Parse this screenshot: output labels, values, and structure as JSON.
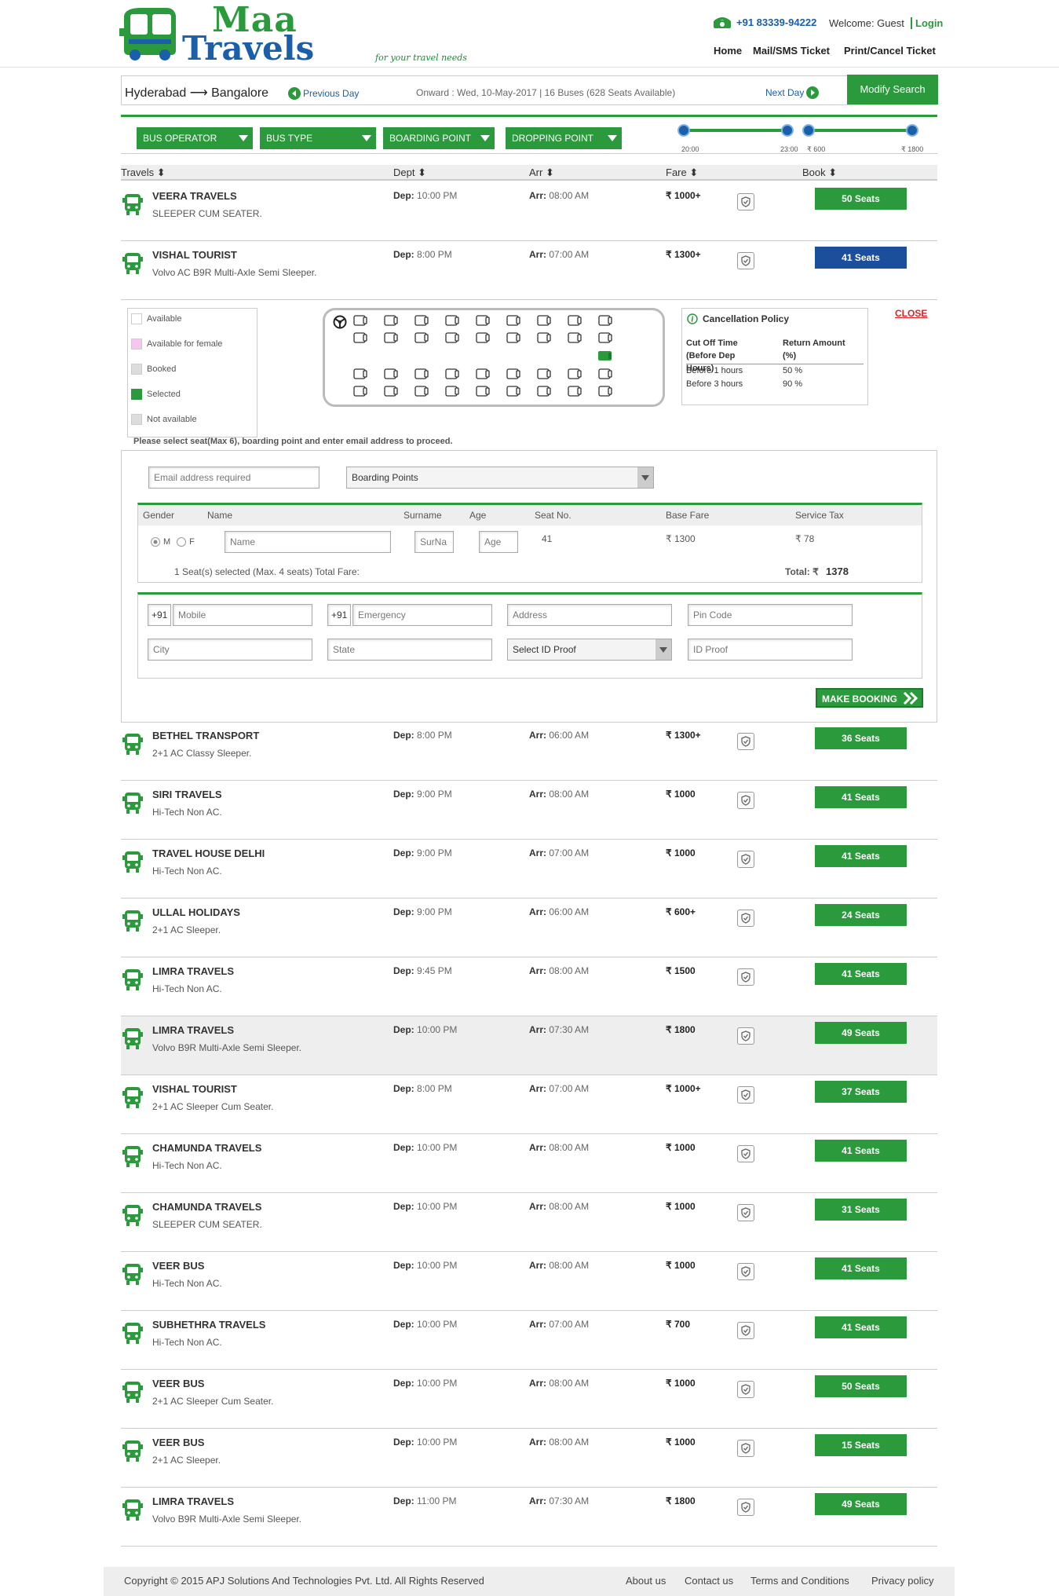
{
  "brand": {
    "name_top": "Maa",
    "name_bottom": "Travels",
    "tagline": "for your travel needs"
  },
  "header": {
    "phone": "+91 83339-94222",
    "welcome": "Welcome: Guest",
    "login": "Login",
    "nav": [
      "Home",
      "Mail/SMS Ticket",
      "Print/Cancel Ticket"
    ]
  },
  "search": {
    "route": "Hyderabad ⟶ Bangalore",
    "prev_day": "Previous Day",
    "onward": "Onward : Wed, 10-May-2017 | 16 Buses (628 Seats Available)",
    "next_day": "Next Day",
    "modify": "Modify Search"
  },
  "filters": {
    "items": [
      "BUS OPERATOR",
      "BUS TYPE",
      "BOARDING POINT",
      "DROPPING POINT"
    ],
    "time_min": "20:00",
    "time_max": "23:00",
    "fare_min": "₹ 600",
    "fare_max": "₹ 1800"
  },
  "columns": [
    "Travels ⬍",
    "Dept ⬍",
    "Arr ⬍",
    "Fare ⬍",
    "Book ⬍"
  ],
  "labels": {
    "dep": "Dep:",
    "arr": "Arr:"
  },
  "buses": [
    {
      "name": "VEERA TRAVELS",
      "type": "SLEEPER CUM SEATER.",
      "dep": "10:00 PM",
      "arr": "08:00 AM",
      "fare": "₹ 1000+",
      "seats": "50 Seats"
    },
    {
      "name": "VISHAL TOURIST",
      "type": "Volvo AC B9R Multi-Axle Semi Sleeper.",
      "dep": "8:00 PM",
      "arr": "07:00 AM",
      "fare": "₹ 1300+",
      "seats": "41 Seats"
    },
    {
      "name": "BETHEL TRANSPORT",
      "type": "2+1 AC Classy Sleeper.",
      "dep": "8:00 PM",
      "arr": "06:00 AM",
      "fare": "₹ 1300+",
      "seats": "36 Seats"
    },
    {
      "name": "SIRI TRAVELS",
      "type": "Hi-Tech Non AC.",
      "dep": "9:00 PM",
      "arr": "08:00 AM",
      "fare": "₹ 1000",
      "seats": "41 Seats"
    },
    {
      "name": "TRAVEL HOUSE DELHI",
      "type": "Hi-Tech Non AC.",
      "dep": "9:00 PM",
      "arr": "07:00 AM",
      "fare": "₹ 1000",
      "seats": "41 Seats"
    },
    {
      "name": "ULLAL HOLIDAYS",
      "type": "2+1 AC Sleeper.",
      "dep": "9:00 PM",
      "arr": "06:00 AM",
      "fare": "₹ 600+",
      "seats": "24 Seats"
    },
    {
      "name": "LIMRA TRAVELS",
      "type": "Hi-Tech Non AC.",
      "dep": "9:45 PM",
      "arr": "08:00 AM",
      "fare": "₹ 1500",
      "seats": "41 Seats"
    },
    {
      "name": "LIMRA TRAVELS",
      "type": "Volvo B9R Multi-Axle Semi Sleeper.",
      "dep": "10:00 PM",
      "arr": "07:30 AM",
      "fare": "₹ 1800",
      "seats": "49 Seats"
    },
    {
      "name": "VISHAL TOURIST",
      "type": "2+1 AC Sleeper Cum Seater.",
      "dep": "8:00 PM",
      "arr": "07:00 AM",
      "fare": "₹ 1000+",
      "seats": "37 Seats"
    },
    {
      "name": "CHAMUNDA TRAVELS",
      "type": "Hi-Tech Non AC.",
      "dep": "10:00 PM",
      "arr": "08:00 AM",
      "fare": "₹ 1000",
      "seats": "41 Seats"
    },
    {
      "name": "CHAMUNDA TRAVELS",
      "type": "SLEEPER CUM SEATER.",
      "dep": "10:00 PM",
      "arr": "08:00 AM",
      "fare": "₹ 1000",
      "seats": "31 Seats"
    },
    {
      "name": "VEER BUS",
      "type": "Hi-Tech Non AC.",
      "dep": "10:00 PM",
      "arr": "08:00 AM",
      "fare": "₹ 1000",
      "seats": "41 Seats"
    },
    {
      "name": "SUBHETHRA TRAVELS",
      "type": "Hi-Tech Non AC.",
      "dep": "10:00 PM",
      "arr": "07:00 AM",
      "fare": "₹ 700",
      "seats": "41 Seats"
    },
    {
      "name": "VEER BUS",
      "type": "2+1 AC Sleeper Cum Seater.",
      "dep": "10:00 PM",
      "arr": "08:00 AM",
      "fare": "₹ 1000",
      "seats": "50 Seats"
    },
    {
      "name": "VEER BUS",
      "type": "2+1 AC Sleeper.",
      "dep": "10:00 PM",
      "arr": "08:00 AM",
      "fare": "₹ 1000",
      "seats": "15 Seats"
    },
    {
      "name": "LIMRA TRAVELS",
      "type": "Volvo B9R Multi-Axle Semi Sleeper.",
      "dep": "11:00 PM",
      "arr": "07:30 AM",
      "fare": "₹ 1800",
      "seats": "49 Seats"
    }
  ],
  "legend": [
    "Available",
    "Available for female",
    "Booked",
    "Selected",
    "Not available"
  ],
  "policy": {
    "title": "Cancellation Policy",
    "col1": "Cut Off Time (Before Dep Hours)",
    "col2": "Return Amount (%)",
    "rows": [
      [
        "Before 1 hours",
        "50 %"
      ],
      [
        "Before 3 hours",
        "90 %"
      ]
    ]
  },
  "close": "CLOSE",
  "note": "Please select seat(Max 6), boarding point and enter email address to proceed.",
  "booking": {
    "email_placeholder": "Email address required",
    "boarding": "Boarding Points",
    "headers": [
      "Gender",
      "Name",
      "Surname",
      "Age",
      "Seat No.",
      "Base Fare",
      "Service Tax"
    ],
    "gender_m": "M",
    "gender_f": "F",
    "name_ph": "Name",
    "surname_ph": "SurNa",
    "age_ph": "Age",
    "seat_no": "41",
    "base_fare": "₹ 1300",
    "service_tax": "₹ 78",
    "selected_note": "1 Seat(s) selected (Max. 4 seats) Total Fare:",
    "total_label": "Total: ₹",
    "total_value": "1378",
    "code": "+91",
    "mobile_ph": "Mobile",
    "emergency_ph": "Emergency",
    "address_ph": "Address",
    "pin_ph": "Pin Code",
    "city_ph": "City",
    "state_ph": "State",
    "id_proof_select": "Select ID Proof",
    "id_proof_ph": "ID Proof",
    "make_booking": "MAKE BOOKING"
  },
  "footer": {
    "copyright": "Copyright © 2015 APJ Solutions And Technologies Pvt. Ltd. All Rights Reserved",
    "links": [
      "About us",
      "Contact us",
      "Terms and Conditions",
      "Privacy policy"
    ]
  },
  "colors": {
    "green": "#2a9a3c",
    "blue": "#1b5fa8",
    "dark_blue": "#1b4f9c"
  }
}
